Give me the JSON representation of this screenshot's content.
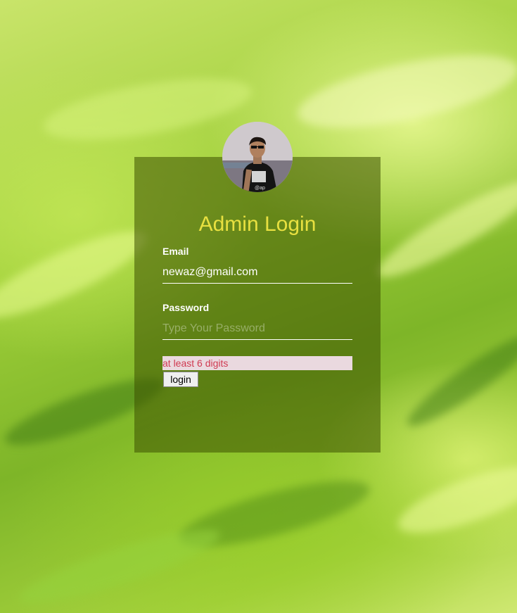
{
  "login": {
    "title": "Admin Login",
    "email_label": "Email",
    "email_value": "newaz@gmail.com",
    "password_label": "Password",
    "password_placeholder": "Type Your Password",
    "error_message": "at least 6 digits",
    "login_button": "login"
  },
  "avatar": {
    "shirt_text": "@ap"
  },
  "colors": {
    "title": "#e8e040",
    "error_text": "#d03a52",
    "error_bg": "#ead9df",
    "card_overlay": "rgba(60, 80, 0, 0.55)"
  }
}
